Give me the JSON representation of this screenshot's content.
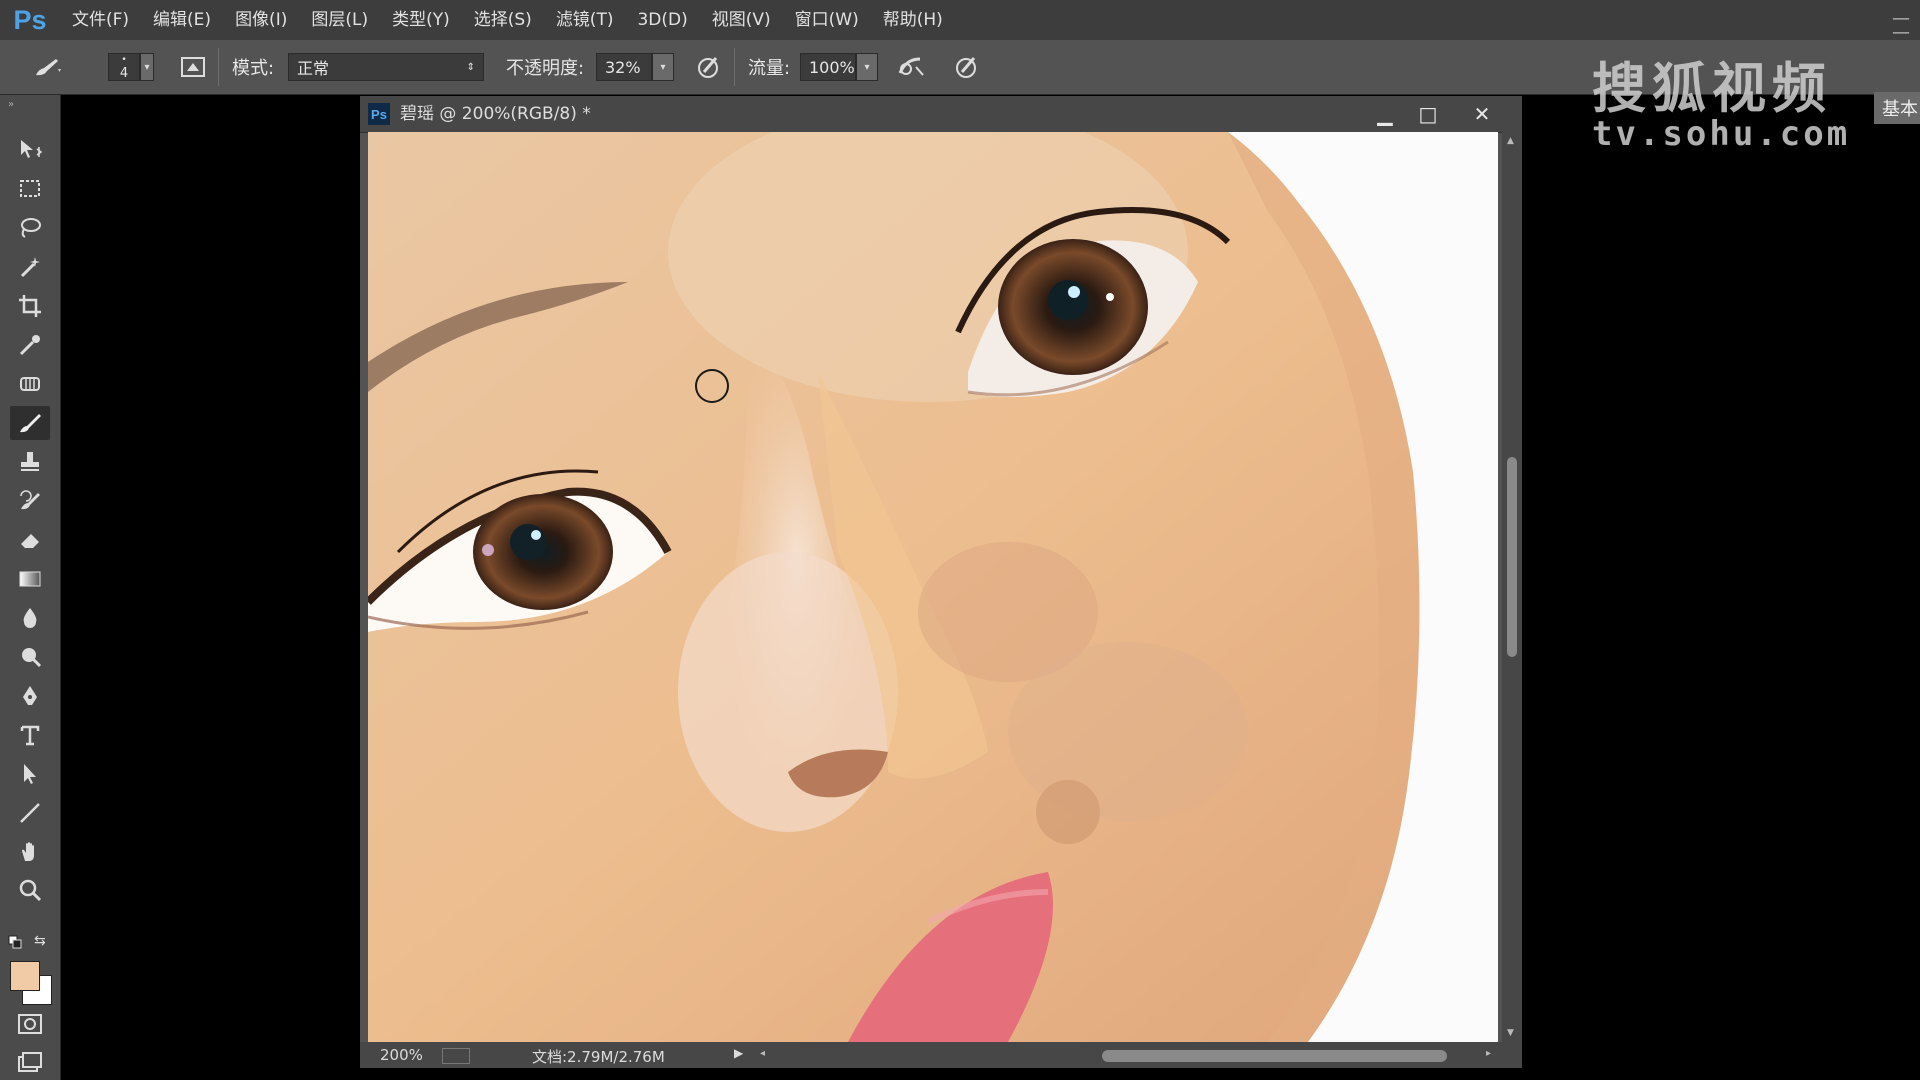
{
  "app": {
    "logo": "Ps"
  },
  "menu": [
    "文件(F)",
    "编辑(E)",
    "图像(I)",
    "图层(L)",
    "类型(Y)",
    "选择(S)",
    "滤镜(T)",
    "3D(D)",
    "视图(V)",
    "窗口(W)",
    "帮助(H)"
  ],
  "options": {
    "brush_size": "4",
    "mode_label": "模式:",
    "mode_value": "正常",
    "opacity_label": "不透明度:",
    "opacity_value": "32%",
    "flow_label": "流量:",
    "flow_value": "100%"
  },
  "watermark": {
    "line1": "搜狐视频",
    "line2": "tv.sohu.com"
  },
  "right_panel_button": "基本",
  "document": {
    "title": "碧瑶 @ 200%(RGB/8) *",
    "zoom": "200%",
    "doc_info": "文档:2.79M/2.76M"
  },
  "colors": {
    "foreground": "#f1cba6",
    "background": "#ffffff",
    "accent": "#4da3e6"
  },
  "tools": [
    "move-icon",
    "marquee-icon",
    "lasso-icon",
    "magic-wand-icon",
    "crop-icon",
    "eyedropper-icon",
    "spot-heal-icon",
    "brush-icon",
    "stamp-icon",
    "history-brush-icon",
    "eraser-icon",
    "gradient-icon",
    "blur-icon",
    "dodge-icon",
    "pen-icon",
    "type-icon",
    "path-select-icon",
    "line-icon",
    "hand-icon",
    "zoom-icon"
  ]
}
